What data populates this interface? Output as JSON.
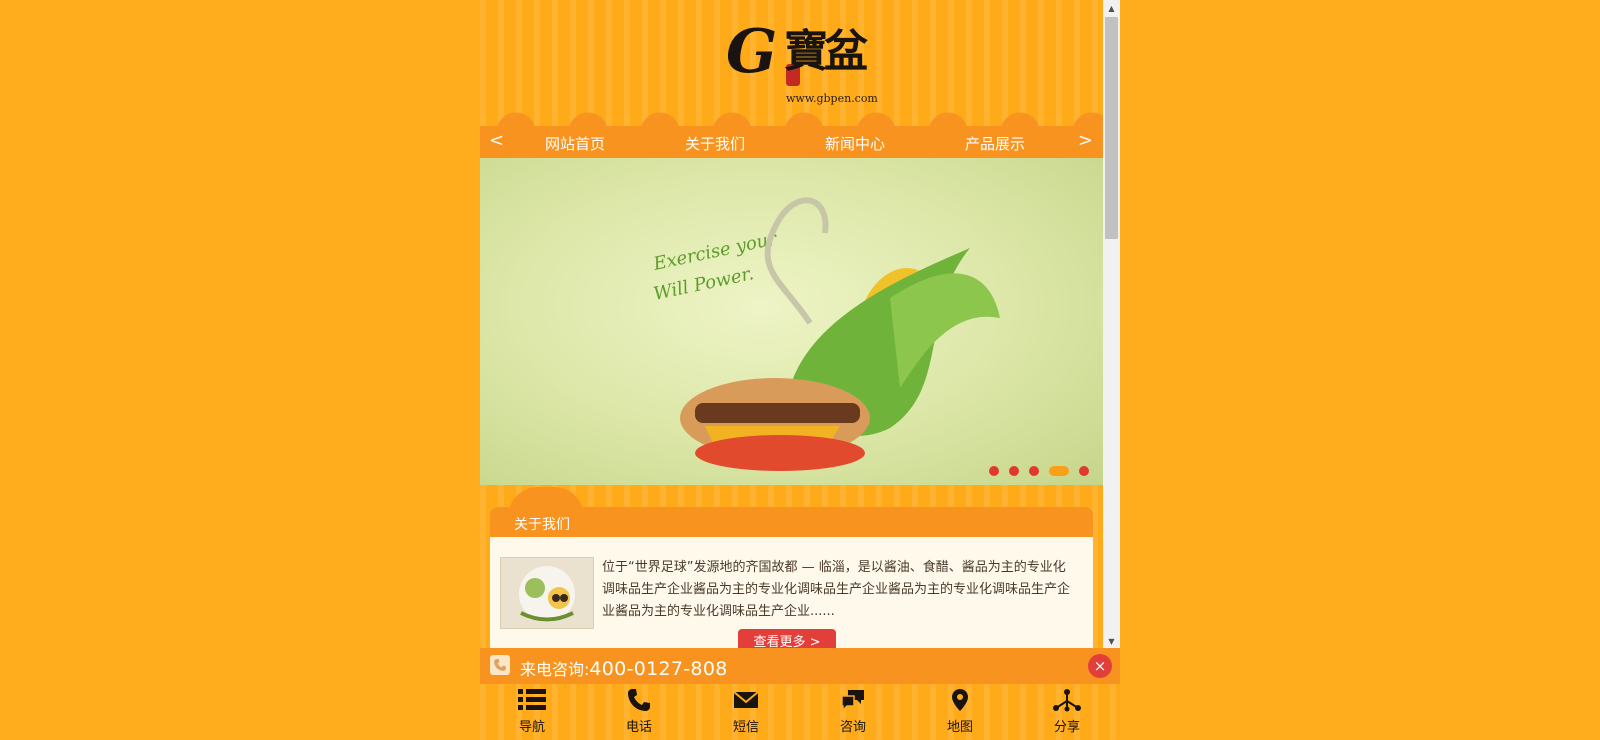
{
  "logo": {
    "glyph": "G",
    "chars": "寶盆",
    "url": "www.gbpen.com"
  },
  "nav": {
    "prev": "<",
    "next": ">",
    "items": [
      "网站首页",
      "关于我们",
      "新闻中心",
      "产品展示"
    ]
  },
  "banner": {
    "slide_text": "Exercise your Will Power",
    "dot_count": 5,
    "active_dot": 4
  },
  "about": {
    "title": "关于我们",
    "text": "位于“世界足球”发源地的齐国故都 — 临淄，是以酱油、食醋、酱品为主的专业化调味品生产企业酱品为主的专业化调味品生产企业酱品为主的专业化调味品生产企业酱品为主的专业化调味品生产企业......",
    "more": "查看更多 >"
  },
  "callbar": {
    "label": "来电咨询:",
    "number": "400-0127-808",
    "close": "×"
  },
  "bottom_nav": [
    {
      "icon": "list-icon",
      "label": "导航"
    },
    {
      "icon": "phone-icon",
      "label": "电话"
    },
    {
      "icon": "envelope-icon",
      "label": "短信"
    },
    {
      "icon": "chat-icon",
      "label": "咨询"
    },
    {
      "icon": "map-pin-icon",
      "label": "地图"
    },
    {
      "icon": "share-icon",
      "label": "分享"
    }
  ],
  "colors": {
    "page_bg": "#FFAD1C",
    "nav_bar": "#F9931F",
    "accent_red": "#E23F3A",
    "content_bg": "#FFF9EB"
  }
}
